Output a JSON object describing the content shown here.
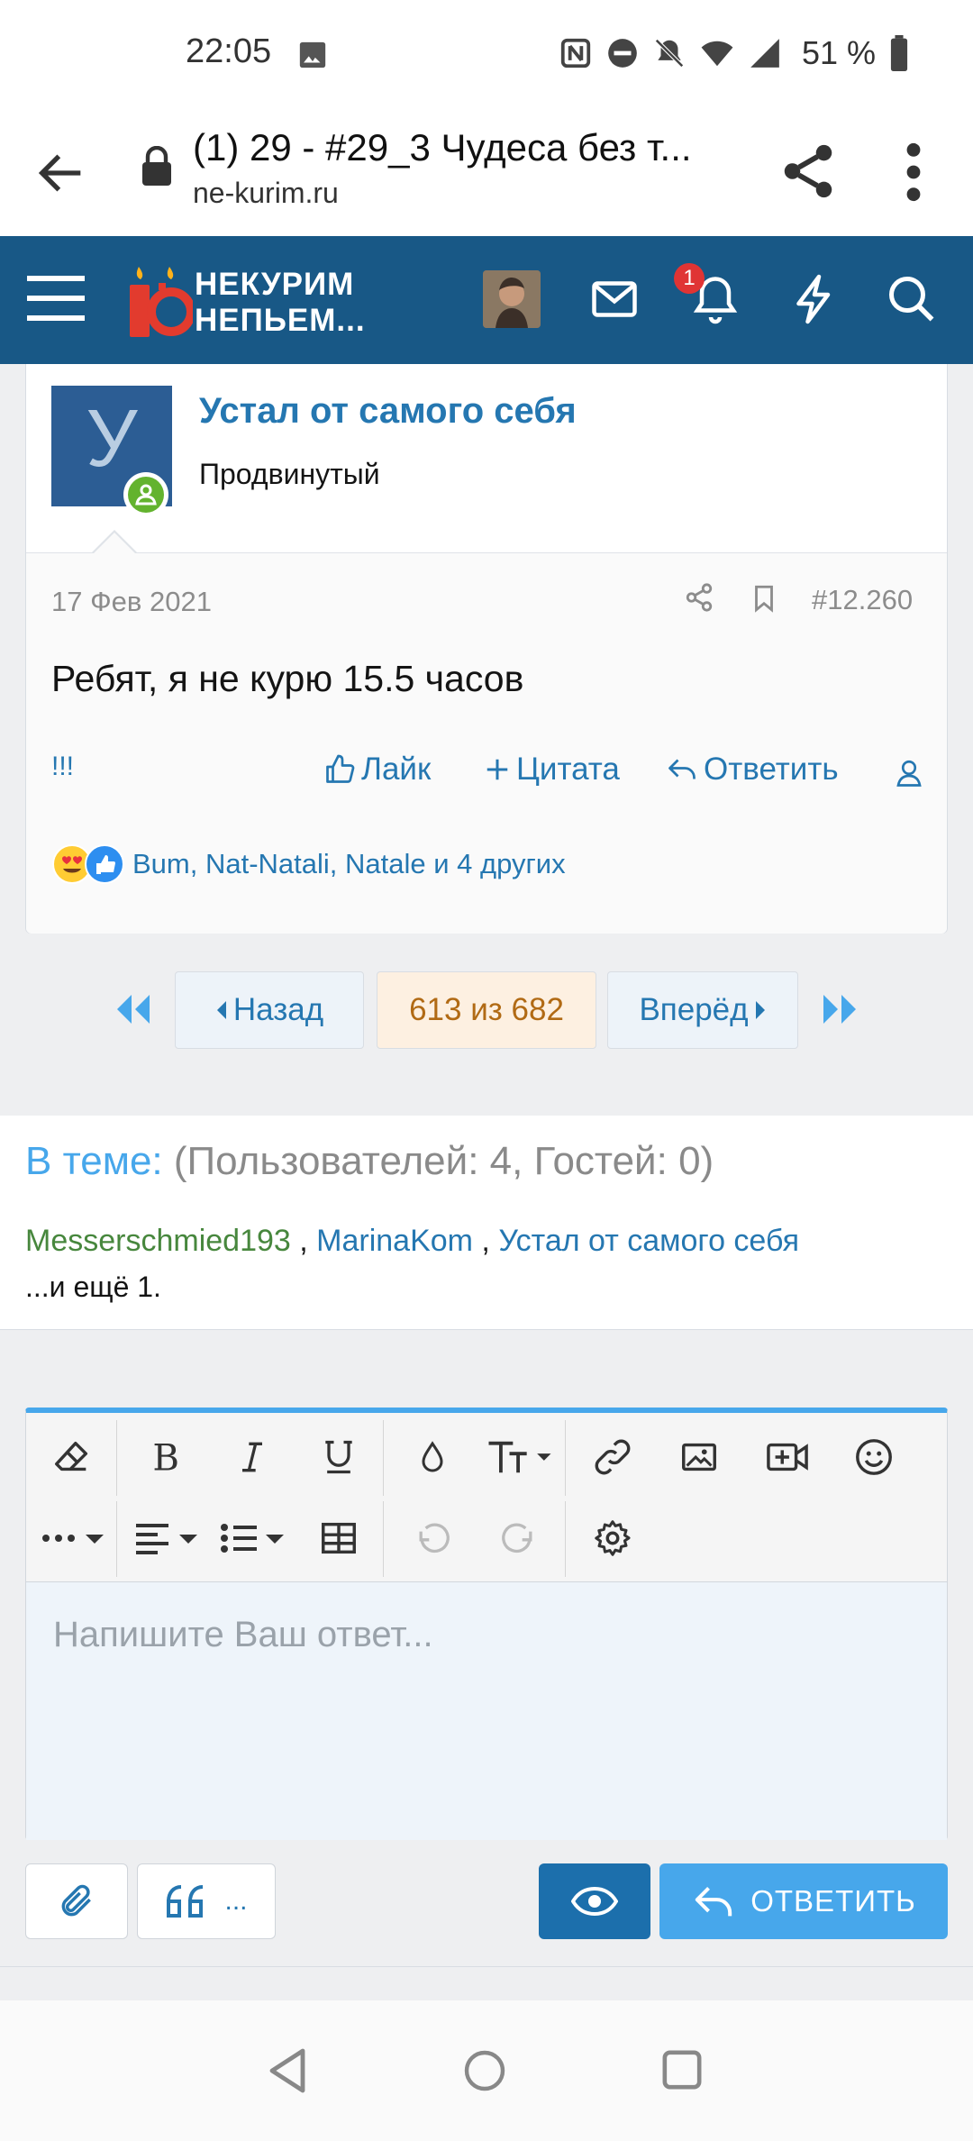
{
  "status_bar": {
    "time": "22:05",
    "battery": "51 %",
    "icons": [
      "image-icon",
      "nfc-icon",
      "dnd-icon",
      "bell-off-icon",
      "wifi-icon",
      "signal-icon",
      "battery-icon"
    ]
  },
  "browser": {
    "page_title": "(1) 29 - #29_3 Чудеса без т...",
    "domain": "ne-kurim.ru"
  },
  "site_header": {
    "logo_line1": "НЕКУРИМ",
    "logo_line2": "НЕПЬЕМ...",
    "notification_count": "1"
  },
  "post": {
    "author_initial": "У",
    "author_name": "Устал от самого себя",
    "author_title": "Продвинутый",
    "date": "17 Фев 2021",
    "post_number": "#12.260",
    "text": "Ребят, я не курю 15.5 часов",
    "exclaim": "!!!",
    "like_label": "Лайк",
    "quote_label": "Цитата",
    "reply_label": "Ответить",
    "reactions_text": "Bum, Nat-Natali, Natale и 4 других"
  },
  "pagination": {
    "prev_label": "Назад",
    "current": "613 из 682",
    "next_label": "Вперёд"
  },
  "online": {
    "label": "В теме:",
    "counts": "(Пользователей: 4, Гостей: 0)",
    "users": [
      "Messerschmied193",
      "MarinaKom",
      "Устал от самого себя"
    ],
    "separator": " , ",
    "more": "...и ещё 1."
  },
  "editor": {
    "placeholder": "Напишите Ваш ответ...",
    "quote_more": "...",
    "reply_button": "ОТВЕТИТЬ"
  },
  "colors": {
    "header_bg": "#185886",
    "link": "#2577b1",
    "accent": "#47a7eb",
    "online_green": "#63b32e"
  }
}
